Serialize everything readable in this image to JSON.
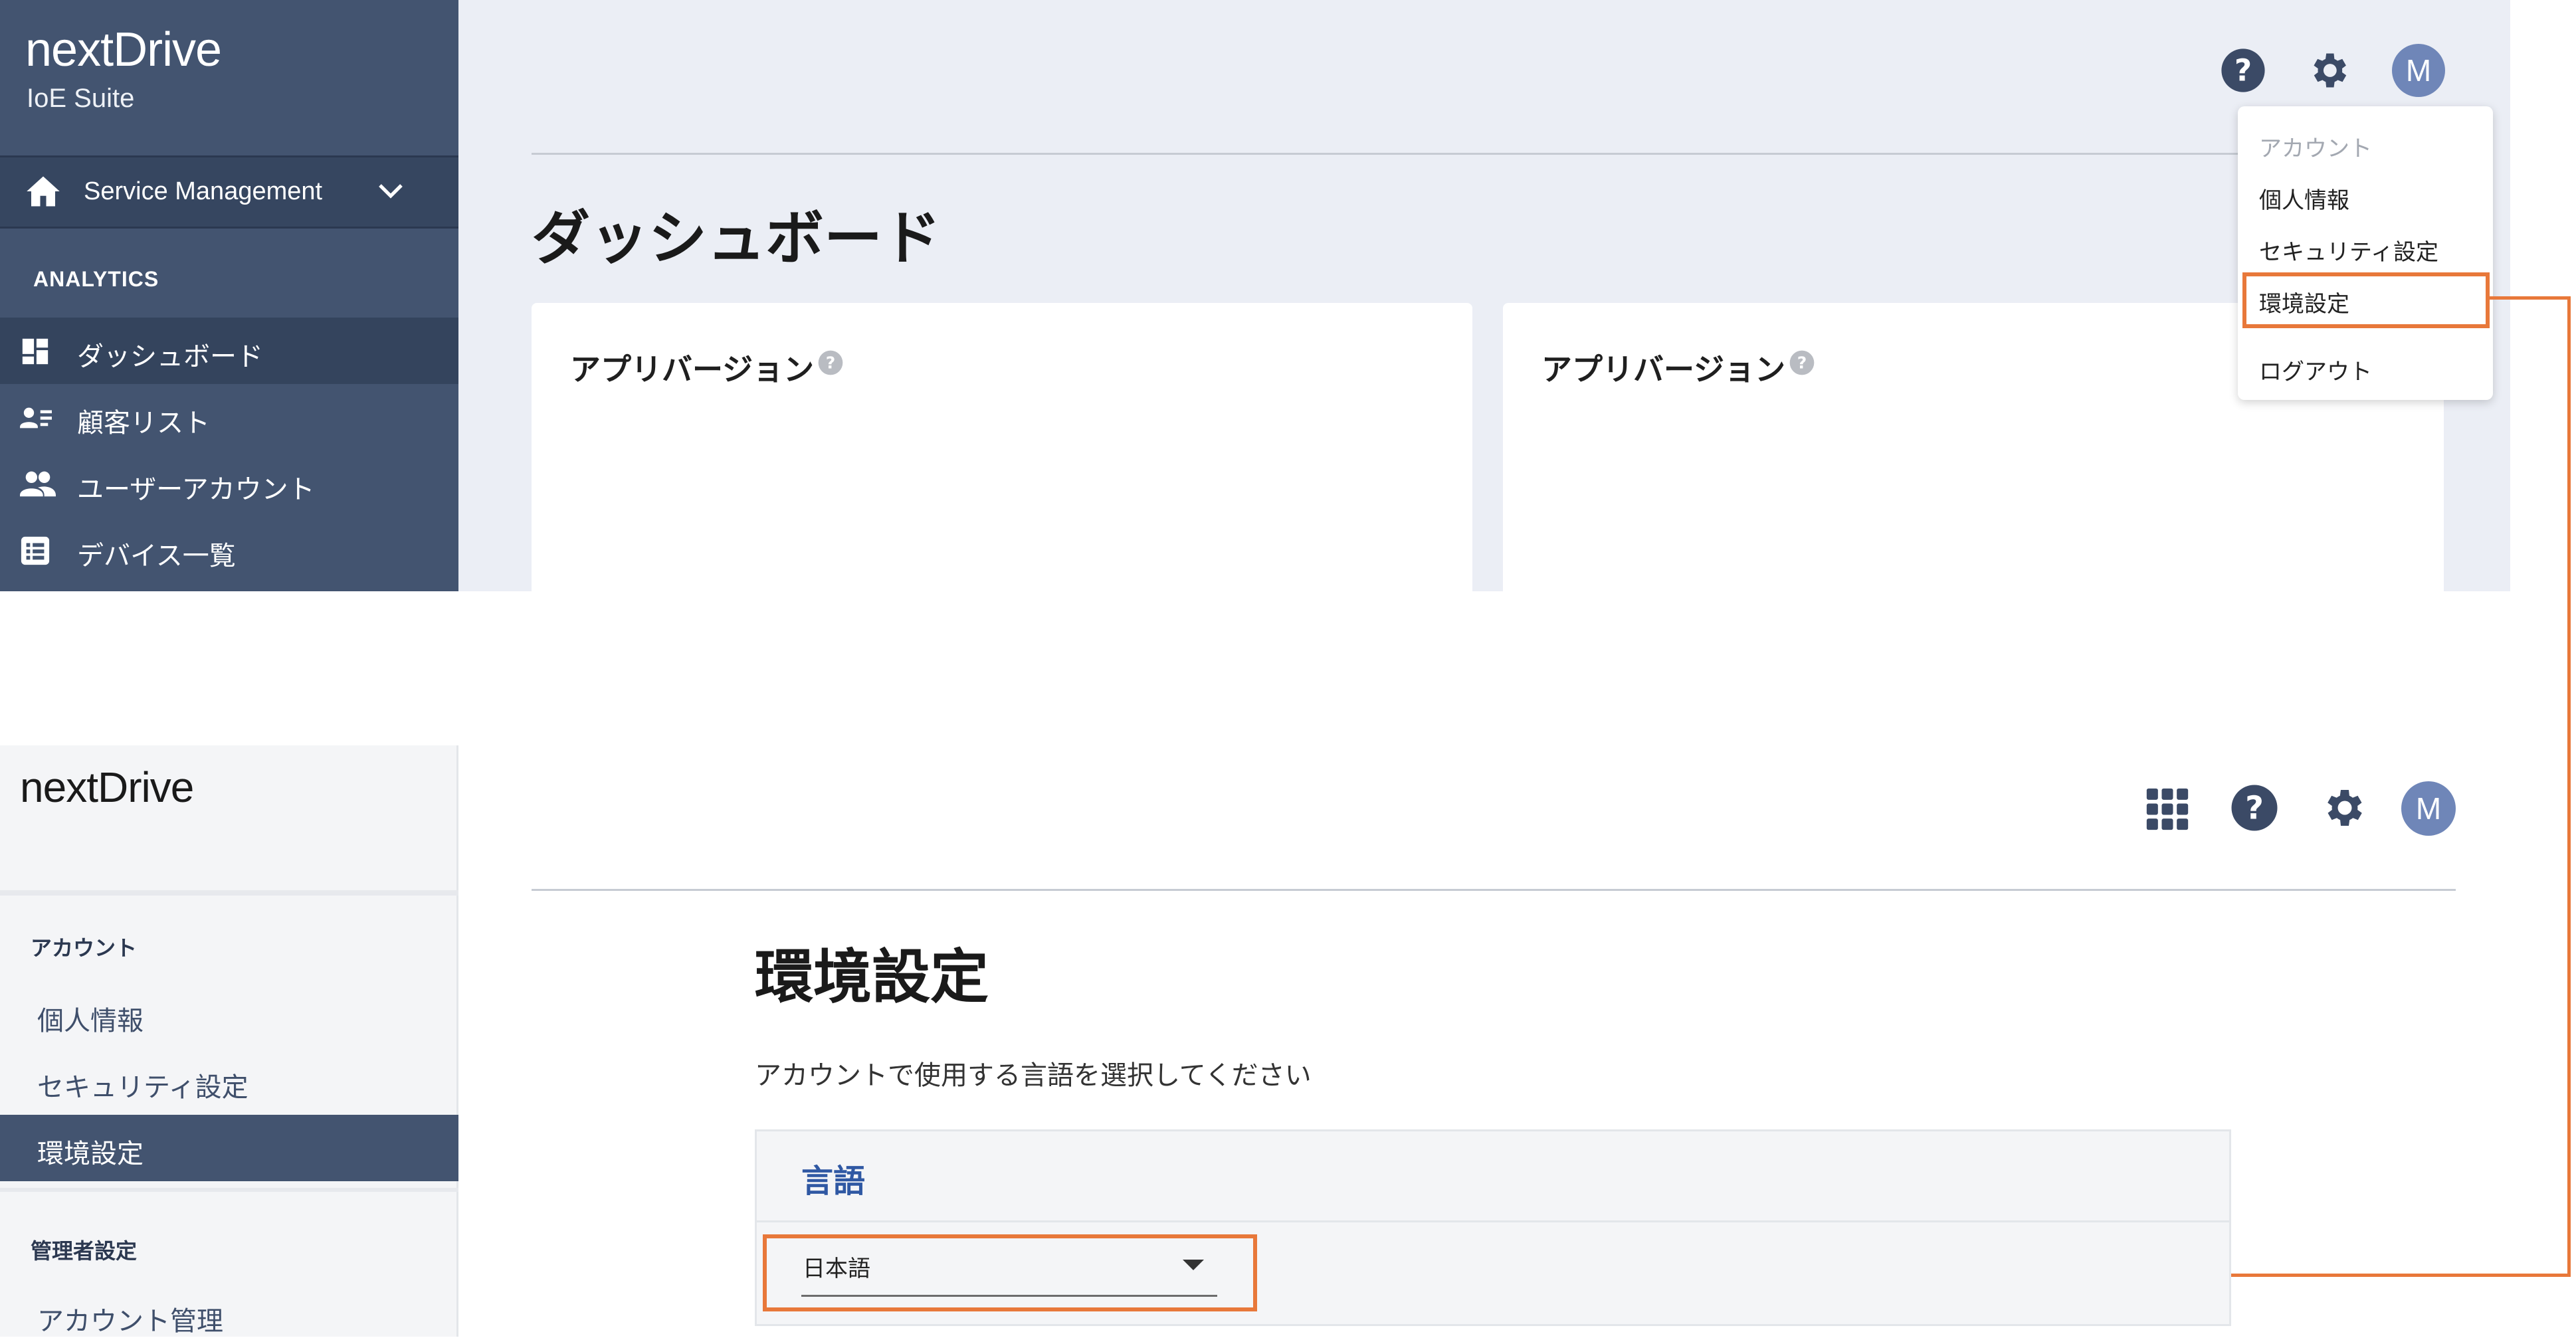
{
  "top": {
    "logo": "nextDrive",
    "suite": "IoE Suite",
    "service_menu": "Service Management",
    "analytics_heading": "ANALYTICS",
    "nav": [
      {
        "label": "ダッシュボード",
        "icon": "dashboard-icon",
        "active": true
      },
      {
        "label": "顧客リスト",
        "icon": "customer-list-icon",
        "active": false
      },
      {
        "label": "ユーザーアカウント",
        "icon": "users-icon",
        "active": false
      },
      {
        "label": "デバイス一覧",
        "icon": "device-list-icon",
        "active": false
      }
    ],
    "page_title": "ダッシュボード",
    "cards": [
      {
        "title": "アプリバージョン"
      },
      {
        "title": "アプリバージョン"
      }
    ],
    "avatar_initial": "M",
    "account_menu": {
      "heading": "アカウント",
      "items": [
        "個人情報",
        "セキュリティ設定",
        "環境設定",
        "ログアウト"
      ]
    }
  },
  "bottom": {
    "logo": "nextDrive",
    "sidebar": {
      "account_heading": "アカウント",
      "account_items": [
        "個人情報",
        "セキュリティ設定",
        "環境設定"
      ],
      "admin_heading": "管理者設定",
      "admin_items": [
        "アカウント管理"
      ]
    },
    "avatar_initial": "M",
    "page_title": "環境設定",
    "description": "アカウントで使用する言語を選択してください",
    "language_heading": "言語",
    "language_value": "日本語"
  },
  "colors": {
    "sidebar_dark": "#435470",
    "highlight": "#e8783a",
    "link_blue": "#2f58a3",
    "avatar": "#6f86b8"
  }
}
